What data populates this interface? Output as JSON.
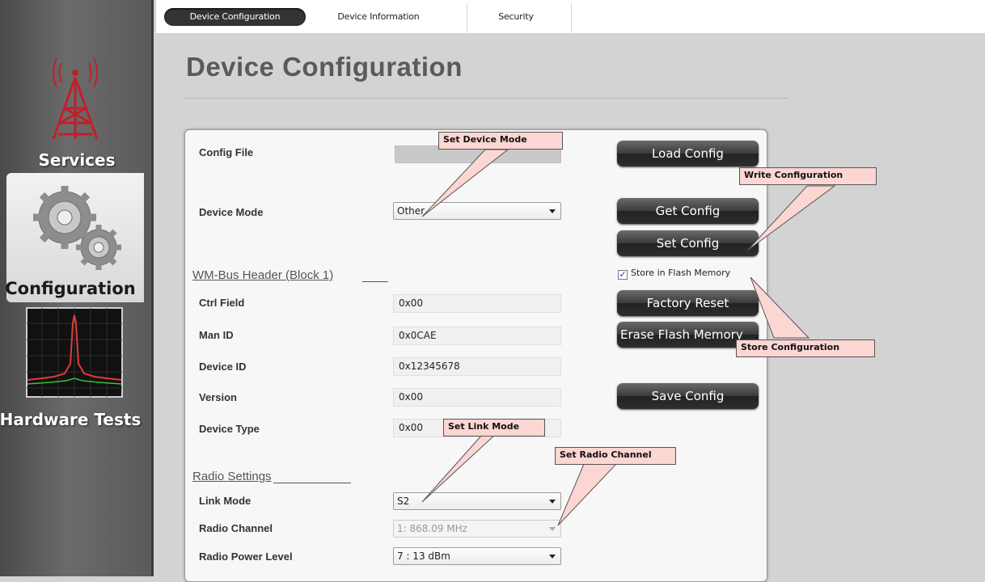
{
  "tabs": [
    {
      "label": "Device Configuration",
      "active": true
    },
    {
      "label": "Device Information",
      "active": false
    },
    {
      "label": "Security",
      "active": false
    }
  ],
  "sidebar": {
    "items": [
      {
        "label": "Services",
        "icon": "radio-tower-icon"
      },
      {
        "label": "Configuration",
        "icon": "gears-icon",
        "selected": true
      },
      {
        "label": "Hardware Tests",
        "icon": "spectrum-icon"
      }
    ]
  },
  "page_title": "Device Configuration",
  "form": {
    "config_file_label": "Config File",
    "config_file_value": "",
    "device_mode_label": "Device Mode",
    "device_mode_value": "Other",
    "header_section": "WM-Bus Header (Block 1)",
    "ctrl_field_label": "Ctrl Field",
    "ctrl_field_value": "0x00",
    "man_id_label": "Man ID",
    "man_id_value": "0x0CAE",
    "device_id_label": "Device ID",
    "device_id_value": "0x12345678",
    "version_label": "Version",
    "version_value": "0x00",
    "device_type_label": "Device Type",
    "device_type_value": "0x00",
    "radio_section": "Radio Settings",
    "link_mode_label": "Link Mode",
    "link_mode_value": "S2",
    "radio_channel_label": "Radio Channel",
    "radio_channel_value": "1: 868.09 MHz",
    "radio_power_label": "Radio Power Level",
    "radio_power_value": "7 : 13 dBm"
  },
  "buttons": {
    "load_config": "Load Config",
    "get_config": "Get Config",
    "set_config": "Set Config",
    "factory_reset": "Factory Reset",
    "erase_flash": "Erase Flash Memory",
    "save_config": "Save Config"
  },
  "store_flash": {
    "label": "Store in Flash Memory",
    "checked": true
  },
  "callouts": {
    "set_device_mode": "Set Device Mode",
    "write_configuration": "Write  Configuration",
    "store_configuration": "Store Configuration",
    "set_link_mode": "Set Link Mode",
    "set_radio_channel": "Set Radio Channel"
  },
  "colors": {
    "callout_fill": "#fbd6d3",
    "button_dark": "#2e2e2e",
    "tower_red": "#c0202a",
    "spectrum_green": "#3bbf3b"
  }
}
